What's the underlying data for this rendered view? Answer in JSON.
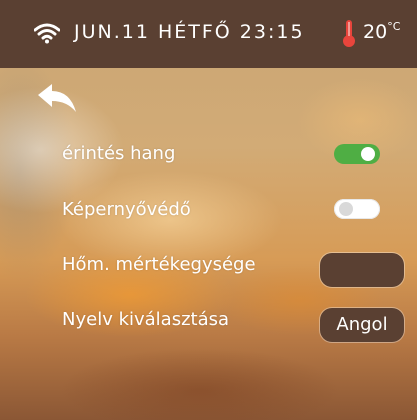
{
  "status_bar": {
    "date_text": "JUN.11  HÉTFŐ  23:15",
    "temperature": "20",
    "temperature_unit": "°C"
  },
  "icons": {
    "wifi": "wifi-icon",
    "thermometer": "thermometer-icon",
    "back": "back-arrow-icon"
  },
  "colors": {
    "status_bar_bg": "#5a4032",
    "toggle_on": "#4fae44",
    "thermometer": "#e8453c"
  },
  "settings": {
    "touch_sound": {
      "label": "érintés hang",
      "enabled": true
    },
    "screensaver": {
      "label": "Képernyővédő",
      "enabled": false
    },
    "temp_unit": {
      "label": "Hőm. mértékegysége",
      "value": ""
    },
    "language": {
      "label": "Nyelv kiválasztása",
      "value": "Angol"
    }
  }
}
